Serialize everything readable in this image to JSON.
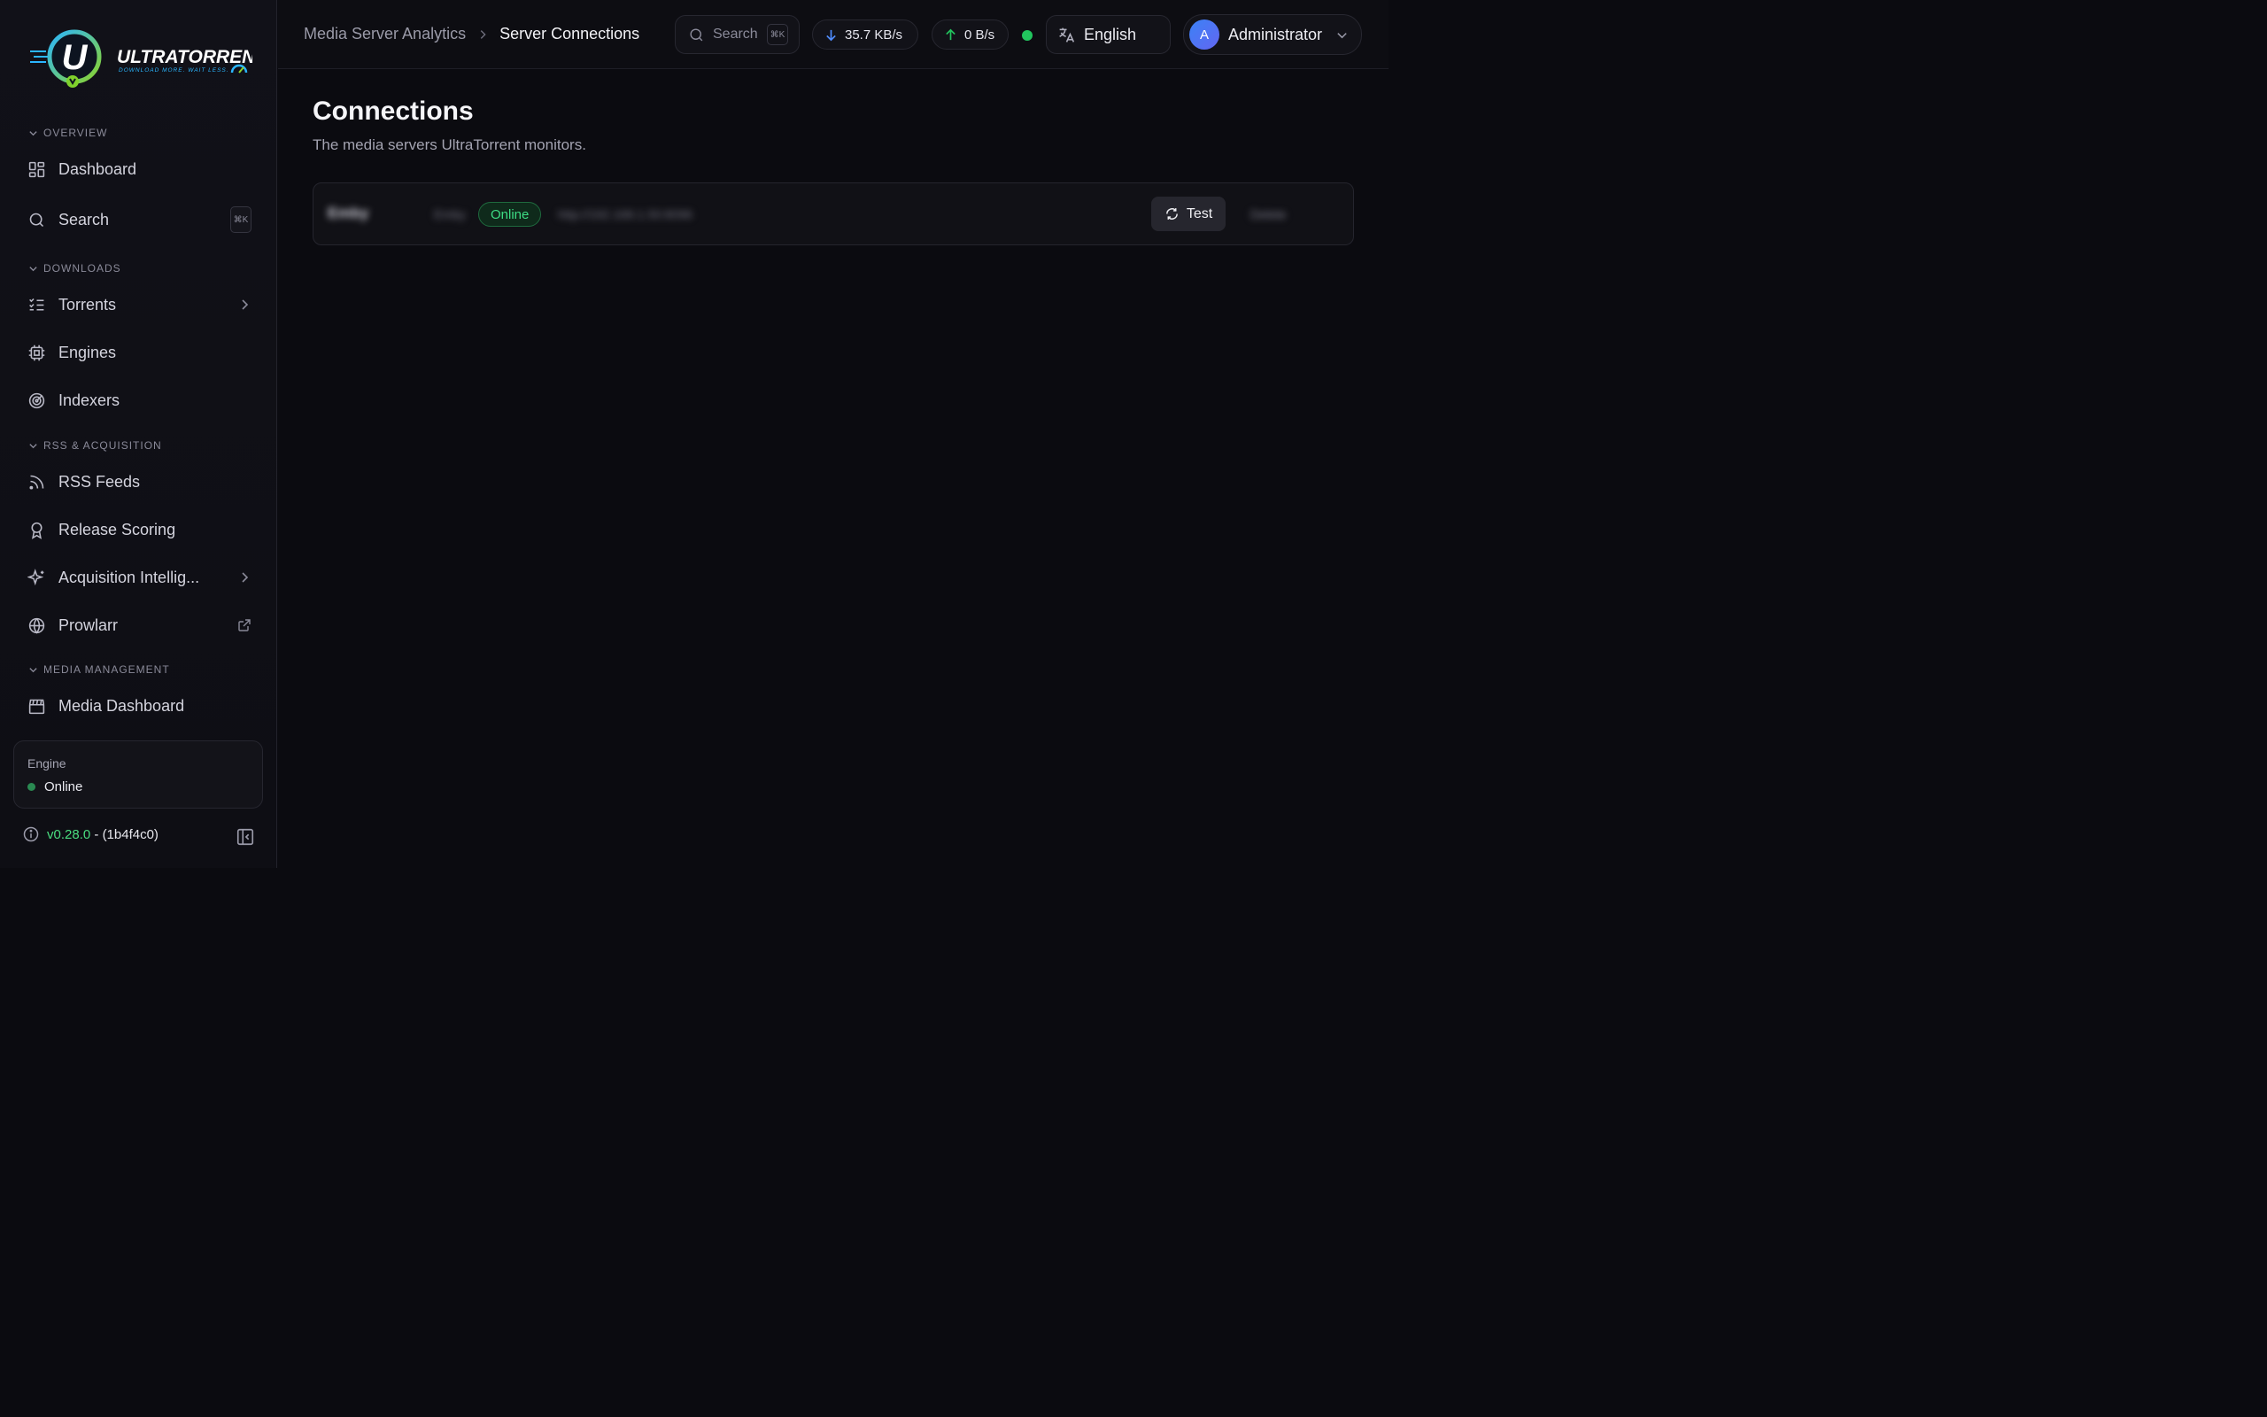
{
  "sidebar": {
    "logo": {
      "brand": "ULTRATORRENT",
      "tagline": "DOWNLOAD MORE. WAIT LESS.",
      "letter": "U"
    },
    "sections": {
      "overview": "OVERVIEW",
      "downloads": "DOWNLOADS",
      "rss": "RSS & ACQUISITION",
      "media": "MEDIA MANAGEMENT"
    },
    "items": {
      "dashboard": "Dashboard",
      "search": "Search",
      "search_kbd": "⌘K",
      "torrents": "Torrents",
      "engines": "Engines",
      "indexers": "Indexers",
      "rss_feeds": "RSS Feeds",
      "release_scoring": "Release Scoring",
      "acquisition": "Acquisition Intellig...",
      "prowlarr": "Prowlarr",
      "media_dashboard": "Media Dashboard"
    },
    "engine": {
      "title": "Engine",
      "status": "Online"
    },
    "version": {
      "number": "v0.28.0",
      "separator": " - ",
      "hash": "(1b4f4c0)"
    }
  },
  "header": {
    "breadcrumb": [
      "Media Server Analytics",
      "Server Connections"
    ],
    "search_label": "Search",
    "search_kbd": "⌘K",
    "download_speed": "35.7 KB/s",
    "upload_speed": "0 B/s",
    "language": "English",
    "user": {
      "initial": "A",
      "name": "Administrator"
    }
  },
  "main": {
    "title": "Connections",
    "subtitle": "The media servers UltraTorrent monitors.",
    "connections": [
      {
        "name": "Emby",
        "type": "Emby",
        "status": "Online",
        "url": "http://192.168.1.50:8096",
        "test_label": "Test",
        "delete_label": "Delete"
      }
    ]
  },
  "colors": {
    "accent_green": "#22c55e",
    "download_blue": "#4f8cff",
    "background": "#0b0b10"
  }
}
